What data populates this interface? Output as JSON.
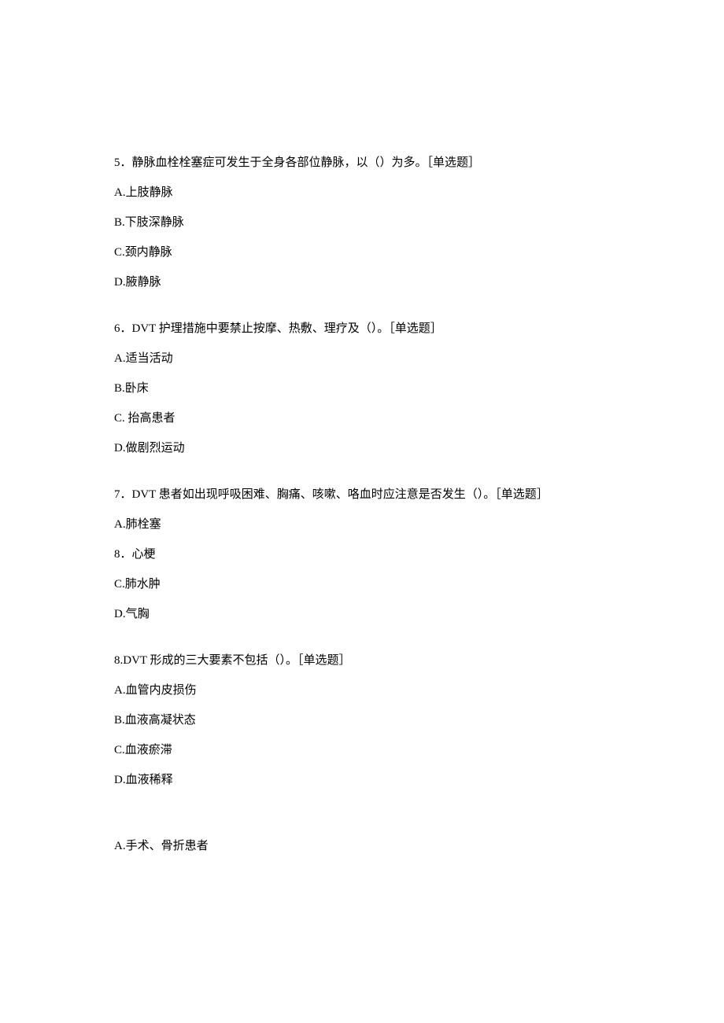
{
  "questions": [
    {
      "number": "5",
      "text": "．静脉血栓栓塞症可发生于全身各部位静脉，以（）为多。［单选题］",
      "options": [
        {
          "label": "A.",
          "text": "上肢静脉"
        },
        {
          "label": "B.",
          "text": "下肢深静脉"
        },
        {
          "label": "C.",
          "text": "颈内静脉"
        },
        {
          "label": "D.",
          "text": "腋静脉"
        }
      ]
    },
    {
      "number": "6",
      "text": "．DVT 护理措施中要禁止按摩、热敷、理疗及（）。［单选题］",
      "options": [
        {
          "label": "A.",
          "text": "适当活动"
        },
        {
          "label": "B.",
          "text": "卧床"
        },
        {
          "label": "C. ",
          "text": "抬高患者"
        },
        {
          "label": "D.",
          "text": "做剧烈运动"
        }
      ]
    },
    {
      "number": "7",
      "text": "．DVT 患者如出现呼吸困难、胸痛、咳嗽、咯血时应注意是否发生（）。［单选题］",
      "options": [
        {
          "label": "A.",
          "text": "肺栓塞"
        },
        {
          "label": "8",
          "text": "．心梗"
        },
        {
          "label": "C.",
          "text": "肺水肿"
        },
        {
          "label": "D.",
          "text": "气胸"
        }
      ]
    },
    {
      "number": "8.",
      "text": "DVT 形成的三大要素不包括（）。［单选题］",
      "options": [
        {
          "label": "A.",
          "text": "血管内皮损伤"
        },
        {
          "label": "B.",
          "text": "血液高凝状态"
        },
        {
          "label": "C.",
          "text": "血液瘀滞"
        },
        {
          "label": "D.",
          "text": "血液稀释"
        }
      ]
    }
  ],
  "orphan": {
    "label": "A.",
    "text": "手术、骨折患者"
  }
}
